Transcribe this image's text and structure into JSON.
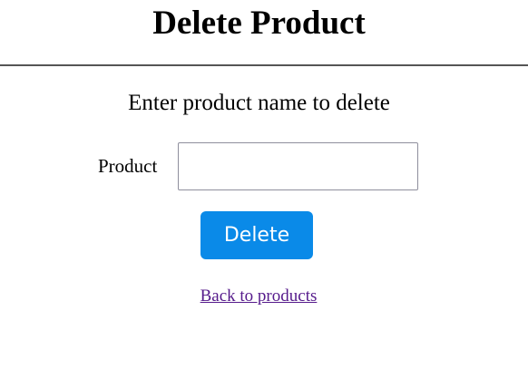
{
  "page": {
    "title": "Delete Product",
    "instruction": "Enter product name to delete"
  },
  "form": {
    "product_label": "Product",
    "product_value": "",
    "product_placeholder": "",
    "delete_label": "Delete"
  },
  "nav": {
    "back_link_label": "Back to products"
  },
  "colors": {
    "button_bg": "#0a8ae8",
    "button_text": "#ffffff",
    "visited_link": "#551a8b",
    "divider": "#555555"
  }
}
